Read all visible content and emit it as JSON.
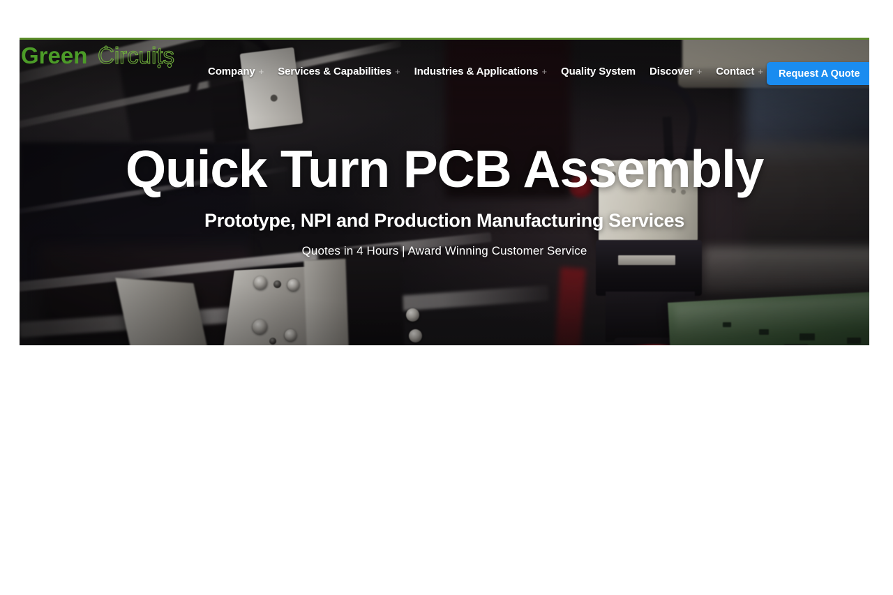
{
  "brand": {
    "name_bold": "Green",
    "name_outline": "Circuits",
    "trademark": "®",
    "green_hex": "#4c9c28",
    "accent_blue_hex": "#1a8cf0",
    "topbar_green_hex": "#5b8c2a"
  },
  "nav": {
    "items": [
      {
        "label": "Company",
        "expander": "+"
      },
      {
        "label": "Services & Capabilities",
        "expander": "+"
      },
      {
        "label": "Industries & Applications",
        "expander": "+"
      },
      {
        "label": "Quality System",
        "expander": ""
      },
      {
        "label": "Discover",
        "expander": "+"
      },
      {
        "label": "Contact",
        "expander": "+"
      }
    ],
    "cta_label": "Request A Quote"
  },
  "hero": {
    "title": "Quick Turn PCB Assembly",
    "subtitle": "Prototype, NPI and Production Manufacturing Services",
    "tagline": "Quotes in 4 Hours | Award Winning Customer Service",
    "background_description": "Close-up photo of an SMT pick-and-place machine placing components on a green printed circuit board"
  }
}
